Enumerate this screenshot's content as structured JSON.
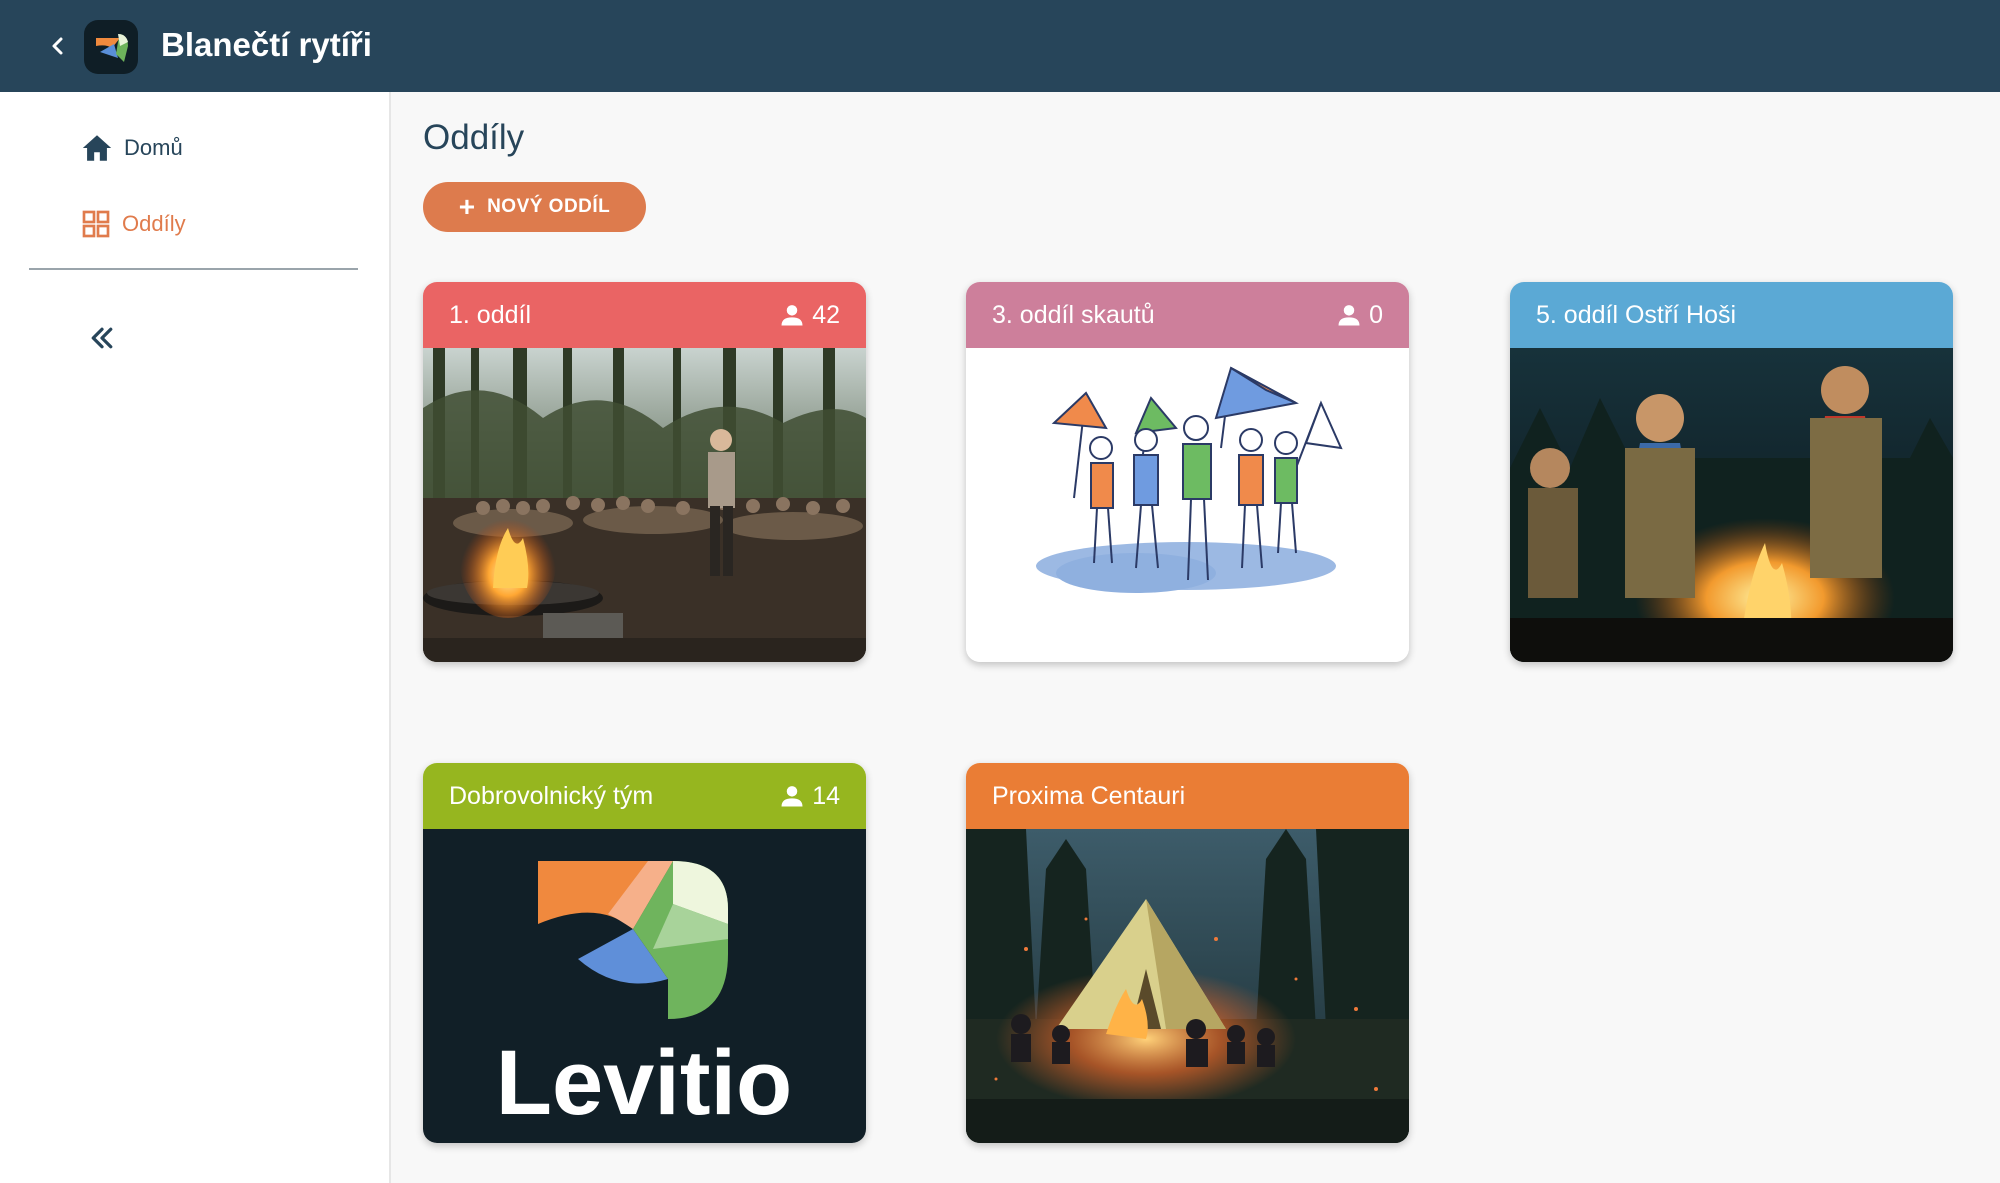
{
  "header": {
    "title": "Blanečtí rytíři"
  },
  "sidebar": {
    "items": [
      {
        "label": "Domů",
        "icon": "home-icon",
        "active": false
      },
      {
        "label": "Oddíly",
        "icon": "grid-icon",
        "active": true
      }
    ],
    "collapse_icon": "double-chevron-left-icon"
  },
  "main": {
    "title": "Oddíly",
    "new_button_label": "NOVÝ ODDÍL",
    "cards": [
      {
        "name": "1. oddíl",
        "count": "42",
        "color": "#ea6464"
      },
      {
        "name": "3. oddíl skautů",
        "count": "0",
        "color": "#cd7f9b"
      },
      {
        "name": "5. oddíl Ostří Hoši",
        "count": "",
        "color": "#5ba9d5"
      },
      {
        "name": "Dobrovolnický tým",
        "count": "14",
        "color": "#96b61f"
      },
      {
        "name": "Proxima Centauri",
        "count": "",
        "color": "#ea7d35"
      }
    ],
    "levitio_logo_text": "Levitio"
  },
  "colors": {
    "topbar": "#27455a",
    "accent": "#dd7b4d",
    "background": "#f8f8f8"
  }
}
